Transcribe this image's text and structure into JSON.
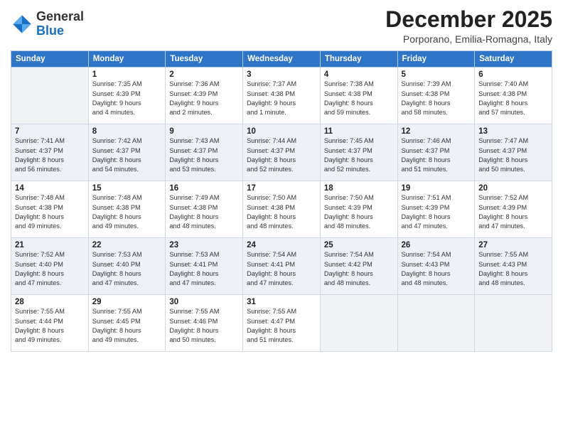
{
  "logo": {
    "general": "General",
    "blue": "Blue"
  },
  "title": "December 2025",
  "subtitle": "Porporano, Emilia-Romagna, Italy",
  "days_of_week": [
    "Sunday",
    "Monday",
    "Tuesday",
    "Wednesday",
    "Thursday",
    "Friday",
    "Saturday"
  ],
  "weeks": [
    [
      {
        "day": "",
        "sunrise": "",
        "sunset": "",
        "daylight": ""
      },
      {
        "day": "1",
        "sunrise": "Sunrise: 7:35 AM",
        "sunset": "Sunset: 4:39 PM",
        "daylight": "Daylight: 9 hours and 4 minutes."
      },
      {
        "day": "2",
        "sunrise": "Sunrise: 7:36 AM",
        "sunset": "Sunset: 4:39 PM",
        "daylight": "Daylight: 9 hours and 2 minutes."
      },
      {
        "day": "3",
        "sunrise": "Sunrise: 7:37 AM",
        "sunset": "Sunset: 4:38 PM",
        "daylight": "Daylight: 9 hours and 1 minute."
      },
      {
        "day": "4",
        "sunrise": "Sunrise: 7:38 AM",
        "sunset": "Sunset: 4:38 PM",
        "daylight": "Daylight: 8 hours and 59 minutes."
      },
      {
        "day": "5",
        "sunrise": "Sunrise: 7:39 AM",
        "sunset": "Sunset: 4:38 PM",
        "daylight": "Daylight: 8 hours and 58 minutes."
      },
      {
        "day": "6",
        "sunrise": "Sunrise: 7:40 AM",
        "sunset": "Sunset: 4:38 PM",
        "daylight": "Daylight: 8 hours and 57 minutes."
      }
    ],
    [
      {
        "day": "7",
        "sunrise": "Sunrise: 7:41 AM",
        "sunset": "Sunset: 4:37 PM",
        "daylight": "Daylight: 8 hours and 56 minutes."
      },
      {
        "day": "8",
        "sunrise": "Sunrise: 7:42 AM",
        "sunset": "Sunset: 4:37 PM",
        "daylight": "Daylight: 8 hours and 54 minutes."
      },
      {
        "day": "9",
        "sunrise": "Sunrise: 7:43 AM",
        "sunset": "Sunset: 4:37 PM",
        "daylight": "Daylight: 8 hours and 53 minutes."
      },
      {
        "day": "10",
        "sunrise": "Sunrise: 7:44 AM",
        "sunset": "Sunset: 4:37 PM",
        "daylight": "Daylight: 8 hours and 52 minutes."
      },
      {
        "day": "11",
        "sunrise": "Sunrise: 7:45 AM",
        "sunset": "Sunset: 4:37 PM",
        "daylight": "Daylight: 8 hours and 52 minutes."
      },
      {
        "day": "12",
        "sunrise": "Sunrise: 7:46 AM",
        "sunset": "Sunset: 4:37 PM",
        "daylight": "Daylight: 8 hours and 51 minutes."
      },
      {
        "day": "13",
        "sunrise": "Sunrise: 7:47 AM",
        "sunset": "Sunset: 4:37 PM",
        "daylight": "Daylight: 8 hours and 50 minutes."
      }
    ],
    [
      {
        "day": "14",
        "sunrise": "Sunrise: 7:48 AM",
        "sunset": "Sunset: 4:38 PM",
        "daylight": "Daylight: 8 hours and 49 minutes."
      },
      {
        "day": "15",
        "sunrise": "Sunrise: 7:48 AM",
        "sunset": "Sunset: 4:38 PM",
        "daylight": "Daylight: 8 hours and 49 minutes."
      },
      {
        "day": "16",
        "sunrise": "Sunrise: 7:49 AM",
        "sunset": "Sunset: 4:38 PM",
        "daylight": "Daylight: 8 hours and 48 minutes."
      },
      {
        "day": "17",
        "sunrise": "Sunrise: 7:50 AM",
        "sunset": "Sunset: 4:38 PM",
        "daylight": "Daylight: 8 hours and 48 minutes."
      },
      {
        "day": "18",
        "sunrise": "Sunrise: 7:50 AM",
        "sunset": "Sunset: 4:39 PM",
        "daylight": "Daylight: 8 hours and 48 minutes."
      },
      {
        "day": "19",
        "sunrise": "Sunrise: 7:51 AM",
        "sunset": "Sunset: 4:39 PM",
        "daylight": "Daylight: 8 hours and 47 minutes."
      },
      {
        "day": "20",
        "sunrise": "Sunrise: 7:52 AM",
        "sunset": "Sunset: 4:39 PM",
        "daylight": "Daylight: 8 hours and 47 minutes."
      }
    ],
    [
      {
        "day": "21",
        "sunrise": "Sunrise: 7:52 AM",
        "sunset": "Sunset: 4:40 PM",
        "daylight": "Daylight: 8 hours and 47 minutes."
      },
      {
        "day": "22",
        "sunrise": "Sunrise: 7:53 AM",
        "sunset": "Sunset: 4:40 PM",
        "daylight": "Daylight: 8 hours and 47 minutes."
      },
      {
        "day": "23",
        "sunrise": "Sunrise: 7:53 AM",
        "sunset": "Sunset: 4:41 PM",
        "daylight": "Daylight: 8 hours and 47 minutes."
      },
      {
        "day": "24",
        "sunrise": "Sunrise: 7:54 AM",
        "sunset": "Sunset: 4:41 PM",
        "daylight": "Daylight: 8 hours and 47 minutes."
      },
      {
        "day": "25",
        "sunrise": "Sunrise: 7:54 AM",
        "sunset": "Sunset: 4:42 PM",
        "daylight": "Daylight: 8 hours and 48 minutes."
      },
      {
        "day": "26",
        "sunrise": "Sunrise: 7:54 AM",
        "sunset": "Sunset: 4:43 PM",
        "daylight": "Daylight: 8 hours and 48 minutes."
      },
      {
        "day": "27",
        "sunrise": "Sunrise: 7:55 AM",
        "sunset": "Sunset: 4:43 PM",
        "daylight": "Daylight: 8 hours and 48 minutes."
      }
    ],
    [
      {
        "day": "28",
        "sunrise": "Sunrise: 7:55 AM",
        "sunset": "Sunset: 4:44 PM",
        "daylight": "Daylight: 8 hours and 49 minutes."
      },
      {
        "day": "29",
        "sunrise": "Sunrise: 7:55 AM",
        "sunset": "Sunset: 4:45 PM",
        "daylight": "Daylight: 8 hours and 49 minutes."
      },
      {
        "day": "30",
        "sunrise": "Sunrise: 7:55 AM",
        "sunset": "Sunset: 4:46 PM",
        "daylight": "Daylight: 8 hours and 50 minutes."
      },
      {
        "day": "31",
        "sunrise": "Sunrise: 7:55 AM",
        "sunset": "Sunset: 4:47 PM",
        "daylight": "Daylight: 8 hours and 51 minutes."
      },
      {
        "day": "",
        "sunrise": "",
        "sunset": "",
        "daylight": ""
      },
      {
        "day": "",
        "sunrise": "",
        "sunset": "",
        "daylight": ""
      },
      {
        "day": "",
        "sunrise": "",
        "sunset": "",
        "daylight": ""
      }
    ]
  ]
}
